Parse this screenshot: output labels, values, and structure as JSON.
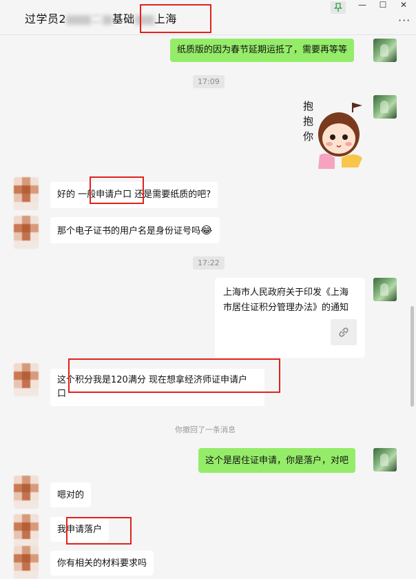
{
  "title": {
    "part1": "过学员2",
    "part2": "二",
    "part3": "基础",
    "part4": "上海"
  },
  "window": {
    "pin_icon": "pin-icon",
    "minimize": "—",
    "maximize": "☐",
    "close": "✕",
    "more": "···"
  },
  "messages": {
    "m1": "纸质版的因为春节延期运抵了，需要再等等",
    "time1": "17:09",
    "sticker_text": "抱抱你",
    "m3": "好的 一般申请户口 还是需要纸质的吧?",
    "m4": "那个电子证书的用户名是身份证号吗",
    "m4_emoji": "😂",
    "time2": "17:22",
    "card_text": "上海市人民政府关于印发《上海市居住证积分管理办法》的通知",
    "m6_line1": "这个积分我是120满分 现在想拿经济师证申请户",
    "m6_line2": "口",
    "recall": "你撤回了一条消息",
    "m8": "这个是居住证申请，你是落户，对吧",
    "m9": "嗯对的",
    "m10": "我申请落户",
    "m11": "你有相关的材料要求吗"
  },
  "colors": {
    "green_bubble": "#95ec69",
    "highlight_box": "#e3201b"
  }
}
